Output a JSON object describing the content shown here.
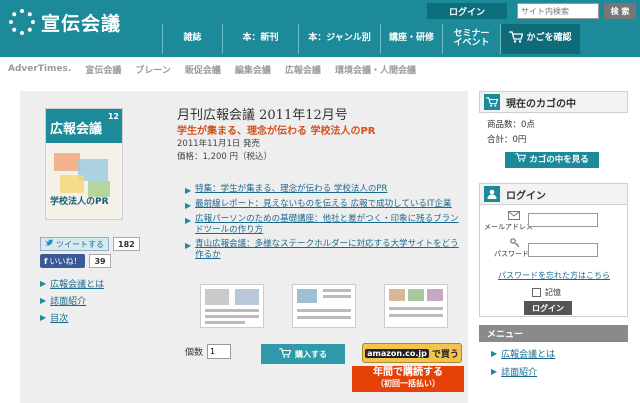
{
  "header": {
    "logo_text": "宣伝会議",
    "login_label": "ログイン",
    "search_placeholder": "サイト内検索",
    "search_button": "検 索",
    "nav": [
      {
        "label": "雑誌"
      },
      {
        "label": "本：新刊"
      },
      {
        "label": "本：ジャンル別"
      },
      {
        "label": "講座・研修"
      },
      {
        "label": "セミナー\nイベント"
      },
      {
        "label": "かごを確認"
      }
    ]
  },
  "subnav": [
    "AdverTimes.",
    "宣伝会議",
    "ブレーン",
    "販促会議",
    "編集会議",
    "広報会議",
    "環境会議・人間会議"
  ],
  "cover": {
    "title": "広報会議",
    "issue": "12",
    "subtitle": "学校法人のPR"
  },
  "product": {
    "title": "月刊広報会議 2011年12月号",
    "subtitle": "学生が集まる、理念が伝わる 学校法人のPR",
    "release": "2011年11月1日 発売",
    "price": "価格：1,200 円（税込）"
  },
  "social": {
    "tweet_label": "ツイートする",
    "tweet_count": "182",
    "like_label": "いいね！",
    "like_count": "39"
  },
  "left_links": [
    "広報会議とは",
    "誌面紹介",
    "目次"
  ],
  "articles": [
    "特集：学生が集まる、理念が伝わる 学校法人のPR",
    "最前線レポート：見えないものを伝える 広報で成功しているIT企業",
    "広報パーソンのための基礎講座：他社と差がつく・印象に残るブランドツールの作り方",
    "青山広報会議：多様なステークホルダーに対応する大学サイトをどう作るか"
  ],
  "purchase": {
    "qty_label": "個数",
    "qty_value": "1",
    "buy_label": "購入する",
    "amazon_logo": "amazon.co.jp",
    "amazon_label": "で買う",
    "annual_line1": "年間で購読する",
    "annual_line2": "（初回一括払い）"
  },
  "cart": {
    "title": "現在のカゴの中",
    "items": "商品数：0点",
    "total": "合計：0円",
    "button": "カゴの中を見る"
  },
  "login": {
    "title": "ログイン",
    "email_label": "メールアドレス",
    "password_label": "パスワード",
    "forgot": "パスワードを忘れた方はこちら",
    "remember": "記憶",
    "button": "ログイン"
  },
  "menu": {
    "title": "メニュー",
    "items": [
      "広報会議とは",
      "誌面紹介"
    ]
  },
  "colors": {
    "brand": "#1d8a99",
    "accent": "#e5420a",
    "link": "#1a6a8e"
  }
}
